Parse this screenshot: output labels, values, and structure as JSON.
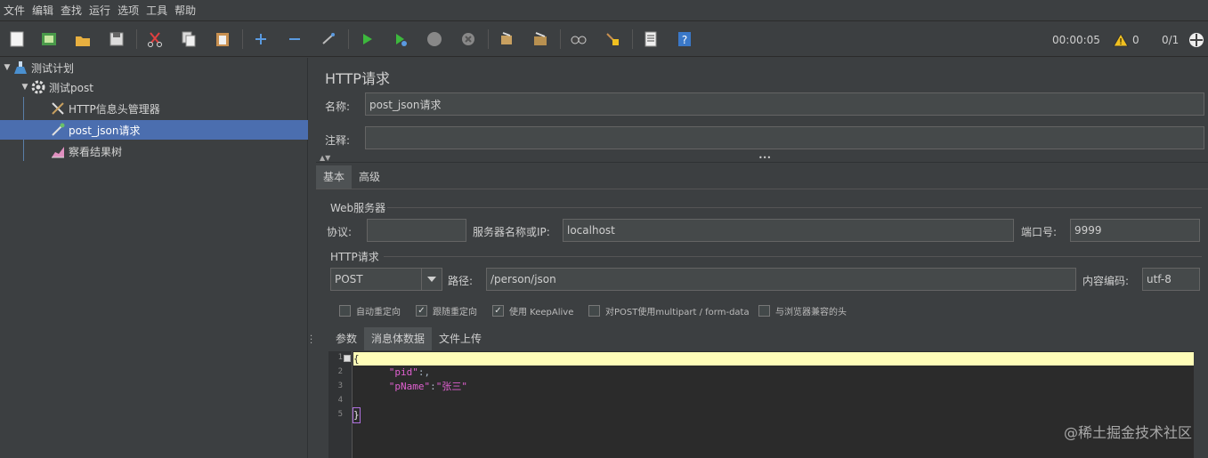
{
  "menu": [
    "文件",
    "编辑",
    "查找",
    "运行",
    "选项",
    "工具",
    "帮助"
  ],
  "toolbar": {
    "timer": "00:00:05",
    "warnings": "0",
    "threads": "0/1"
  },
  "tree": {
    "items": [
      {
        "label": "测试计划"
      },
      {
        "label": "测试post"
      },
      {
        "label": "HTTP信息头管理器"
      },
      {
        "label": "post_json请求"
      },
      {
        "label": "察看结果树"
      }
    ]
  },
  "panel": {
    "title": "HTTP请求",
    "name_label": "名称:",
    "name_value": "post_json请求",
    "comment_label": "注释:",
    "comment_value": "",
    "tabs": [
      "基本",
      "高级"
    ],
    "web_server": {
      "title": "Web服务器",
      "protocol_label": "协议:",
      "protocol_value": "",
      "server_label": "服务器名称或IP:",
      "server_value": "localhost",
      "port_label": "端口号:",
      "port_value": "9999"
    },
    "http_request": {
      "title": "HTTP请求",
      "method": "POST",
      "path_label": "路径:",
      "path_value": "/person/json",
      "encoding_label": "内容编码:",
      "encoding_value": "utf-8"
    },
    "checkboxes": [
      {
        "label": "自动重定向",
        "checked": false
      },
      {
        "label": "跟随重定向",
        "checked": true
      },
      {
        "label": "使用 KeepAlive",
        "checked": true
      },
      {
        "label": "对POST使用multipart / form-data",
        "checked": false
      },
      {
        "label": "与浏览器兼容的头",
        "checked": false
      }
    ],
    "body_tabs": [
      "参数",
      "消息体数据",
      "文件上传"
    ],
    "editor": {
      "line_numbers": [
        "1",
        "2",
        "3",
        "4",
        "5"
      ],
      "lines": [
        {
          "text": "{"
        },
        {
          "key": "\"pid\"",
          "sep": ":",
          "val": "",
          "tail": ","
        },
        {
          "key": "\"pName\"",
          "sep": ":",
          "val": "\"张三\"",
          "tail": ""
        },
        {
          "text": ""
        },
        {
          "text": "}"
        }
      ]
    }
  },
  "watermark": "@稀土掘金技术社区"
}
